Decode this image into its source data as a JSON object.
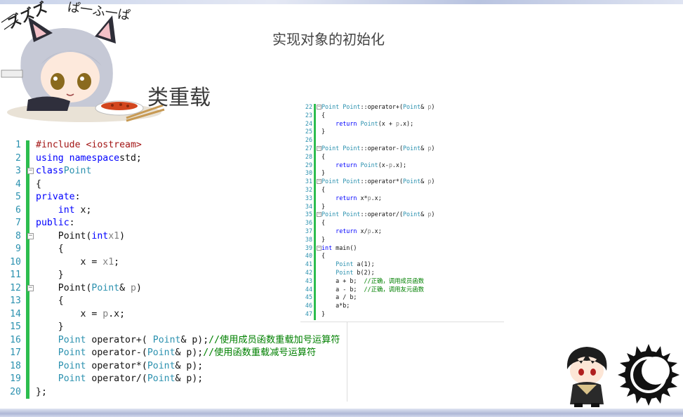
{
  "slide": {
    "title": "实现对象的初始化",
    "subtitle": "类重载",
    "sound_effect_left": "ズズズ",
    "sound_effect_right": "ぱ一ふ一ぱ"
  },
  "decorations": {
    "top_left": "catgirl-illustration-icon",
    "bottom_right_character": "anime-character-icon",
    "bottom_right_logo": "sun-moon-logo-icon"
  },
  "colors": {
    "line_number": "#2b91af",
    "keyword": "#0000ff",
    "type": "#2b91af",
    "comment": "#008000",
    "change_bar": "#2dbd4e"
  },
  "code_left": {
    "lines": [
      {
        "n": "1",
        "parts": [
          [
            "pp",
            "#include <iostream>"
          ]
        ]
      },
      {
        "n": "2",
        "parts": [
          [
            "kw",
            "using namespace"
          ],
          [
            "",
            "std;"
          ]
        ]
      },
      {
        "n": "3",
        "fold": true,
        "parts": [
          [
            "kw",
            "class"
          ],
          [
            "",
            ""
          ],
          [
            "ty",
            "Point"
          ]
        ]
      },
      {
        "n": "4",
        "parts": [
          [
            "",
            "{"
          ]
        ]
      },
      {
        "n": "5",
        "parts": [
          [
            "kw",
            "private"
          ],
          [
            "",
            ":"
          ]
        ]
      },
      {
        "n": "6",
        "parts": [
          [
            "",
            "    "
          ],
          [
            "kw",
            "int"
          ],
          [
            "",
            " x;"
          ]
        ]
      },
      {
        "n": "7",
        "parts": [
          [
            "kw",
            "public"
          ],
          [
            "",
            ":"
          ]
        ]
      },
      {
        "n": "8",
        "fold": true,
        "parts": [
          [
            "",
            "    Point("
          ],
          [
            "kw",
            "int"
          ],
          [
            "",
            ""
          ],
          [
            "pm",
            "x1"
          ],
          [
            "",
            ")"
          ]
        ]
      },
      {
        "n": "9",
        "parts": [
          [
            "",
            "    {"
          ]
        ]
      },
      {
        "n": "10",
        "parts": [
          [
            "",
            "        x = "
          ],
          [
            "pm",
            "x1"
          ],
          [
            "",
            ";"
          ]
        ]
      },
      {
        "n": "11",
        "parts": [
          [
            "",
            "    }"
          ]
        ]
      },
      {
        "n": "12",
        "fold": true,
        "parts": [
          [
            "",
            "    Point("
          ],
          [
            "ty",
            "Point"
          ],
          [
            "",
            "& "
          ],
          [
            "pm",
            "p"
          ],
          [
            "",
            ")"
          ]
        ]
      },
      {
        "n": "13",
        "parts": [
          [
            "",
            "    {"
          ]
        ]
      },
      {
        "n": "14",
        "parts": [
          [
            "",
            "        x = "
          ],
          [
            "pm",
            "p"
          ],
          [
            "",
            ".x;"
          ]
        ]
      },
      {
        "n": "15",
        "parts": [
          [
            "",
            "    }"
          ]
        ]
      },
      {
        "n": "16",
        "parts": [
          [
            "",
            "    "
          ],
          [
            "ty",
            "Point"
          ],
          [
            "",
            " operator+( "
          ],
          [
            "ty",
            "Point"
          ],
          [
            "",
            "& p);"
          ],
          [
            "cm",
            "//使用成员函数重载加号运算符"
          ]
        ]
      },
      {
        "n": "17",
        "parts": [
          [
            "",
            "    "
          ],
          [
            "ty",
            "Point"
          ],
          [
            "",
            " operator-("
          ],
          [
            "ty",
            "Point"
          ],
          [
            "",
            "& p);"
          ],
          [
            "cm",
            "//使用函数重载减号运算符"
          ]
        ]
      },
      {
        "n": "18",
        "parts": [
          [
            "",
            "    "
          ],
          [
            "ty",
            "Point"
          ],
          [
            "",
            " operator*("
          ],
          [
            "ty",
            "Point"
          ],
          [
            "",
            "& p);"
          ]
        ]
      },
      {
        "n": "19",
        "parts": [
          [
            "",
            "    "
          ],
          [
            "ty",
            "Point"
          ],
          [
            "",
            " operator/("
          ],
          [
            "ty",
            "Point"
          ],
          [
            "",
            "& p);"
          ]
        ]
      },
      {
        "n": "20",
        "parts": [
          [
            "",
            "};"
          ]
        ]
      }
    ]
  },
  "code_right": {
    "lines": [
      {
        "n": "22",
        "fold": true,
        "parts": [
          [
            "ty",
            "Point"
          ],
          [
            "",
            " "
          ],
          [
            "ty",
            "Point"
          ],
          [
            "",
            "::operator+("
          ],
          [
            "ty",
            "Point"
          ],
          [
            "",
            "& "
          ],
          [
            "pm",
            "p"
          ],
          [
            "",
            ")"
          ]
        ]
      },
      {
        "n": "23",
        "parts": [
          [
            "",
            "{"
          ]
        ]
      },
      {
        "n": "24",
        "parts": [
          [
            "",
            "    "
          ],
          [
            "kw",
            "return"
          ],
          [
            "",
            " "
          ],
          [
            "ty",
            "Point"
          ],
          [
            "",
            "(x + "
          ],
          [
            "pm",
            "p"
          ],
          [
            "",
            ".x);"
          ]
        ]
      },
      {
        "n": "25",
        "parts": [
          [
            "",
            "}"
          ]
        ]
      },
      {
        "n": "26",
        "parts": [
          [
            "",
            ""
          ]
        ]
      },
      {
        "n": "27",
        "fold": true,
        "parts": [
          [
            "ty",
            "Point"
          ],
          [
            "",
            " "
          ],
          [
            "ty",
            "Point"
          ],
          [
            "",
            "::operator-("
          ],
          [
            "ty",
            "Point"
          ],
          [
            "",
            "& "
          ],
          [
            "pm",
            "p"
          ],
          [
            "",
            ")"
          ]
        ]
      },
      {
        "n": "28",
        "parts": [
          [
            "",
            "{"
          ]
        ]
      },
      {
        "n": "29",
        "parts": [
          [
            "",
            "    "
          ],
          [
            "kw",
            "return"
          ],
          [
            "",
            " "
          ],
          [
            "ty",
            "Point"
          ],
          [
            "",
            "(x-"
          ],
          [
            "pm",
            "p"
          ],
          [
            "",
            ".x);"
          ]
        ]
      },
      {
        "n": "30",
        "parts": [
          [
            "",
            "}"
          ]
        ]
      },
      {
        "n": "31",
        "fold": true,
        "parts": [
          [
            "ty",
            "Point"
          ],
          [
            "",
            " "
          ],
          [
            "ty",
            "Point"
          ],
          [
            "",
            "::operator*("
          ],
          [
            "ty",
            "Point"
          ],
          [
            "",
            "& "
          ],
          [
            "pm",
            "p"
          ],
          [
            "",
            ")"
          ]
        ]
      },
      {
        "n": "32",
        "parts": [
          [
            "",
            "{"
          ]
        ]
      },
      {
        "n": "33",
        "parts": [
          [
            "",
            "    "
          ],
          [
            "kw",
            "return"
          ],
          [
            "",
            " x*"
          ],
          [
            "pm",
            "p"
          ],
          [
            "",
            ".x;"
          ]
        ]
      },
      {
        "n": "34",
        "parts": [
          [
            "",
            "}"
          ]
        ]
      },
      {
        "n": "35",
        "fold": true,
        "parts": [
          [
            "ty",
            "Point"
          ],
          [
            "",
            " "
          ],
          [
            "ty",
            "Point"
          ],
          [
            "",
            "::operator/("
          ],
          [
            "ty",
            "Point"
          ],
          [
            "",
            "& "
          ],
          [
            "pm",
            "p"
          ],
          [
            "",
            ")"
          ]
        ]
      },
      {
        "n": "36",
        "parts": [
          [
            "",
            "{"
          ]
        ]
      },
      {
        "n": "37",
        "parts": [
          [
            "",
            "    "
          ],
          [
            "kw",
            "return"
          ],
          [
            "",
            " x/"
          ],
          [
            "pm",
            "p"
          ],
          [
            "",
            ".x;"
          ]
        ]
      },
      {
        "n": "38",
        "parts": [
          [
            "",
            "}"
          ]
        ]
      },
      {
        "n": "39",
        "fold": true,
        "parts": [
          [
            "kw",
            "int"
          ],
          [
            "",
            " main()"
          ]
        ]
      },
      {
        "n": "40",
        "parts": [
          [
            "",
            "{"
          ]
        ]
      },
      {
        "n": "41",
        "parts": [
          [
            "",
            "    "
          ],
          [
            "ty",
            "Point"
          ],
          [
            "",
            " a(1);"
          ]
        ]
      },
      {
        "n": "42",
        "parts": [
          [
            "",
            "    "
          ],
          [
            "ty",
            "Point"
          ],
          [
            "",
            " b(2);"
          ]
        ]
      },
      {
        "n": "43",
        "parts": [
          [
            "",
            "    a + b;  "
          ],
          [
            "cm",
            "//正确，调用成员函数"
          ]
        ]
      },
      {
        "n": "44",
        "parts": [
          [
            "",
            "    a - b;  "
          ],
          [
            "cm",
            "//正确，调用友元函数"
          ]
        ]
      },
      {
        "n": "45",
        "parts": [
          [
            "",
            "    a / b;"
          ]
        ]
      },
      {
        "n": "46",
        "parts": [
          [
            "",
            "    a*b;"
          ]
        ]
      },
      {
        "n": "47",
        "parts": [
          [
            "",
            "}"
          ]
        ]
      }
    ]
  }
}
